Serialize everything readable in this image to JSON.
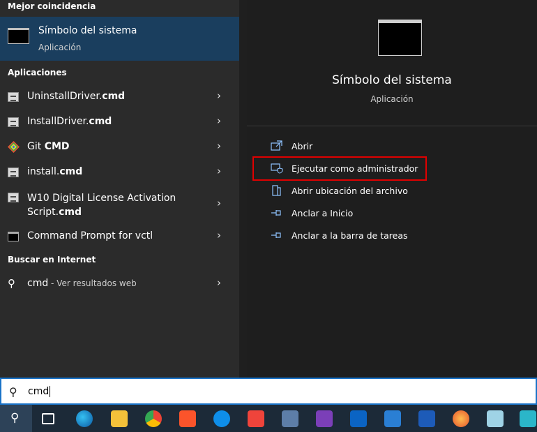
{
  "left": {
    "best_match_heading": "Mejor coincidencia",
    "best_match": {
      "title": "Símbolo del sistema",
      "subtitle": "Aplicación"
    },
    "apps_heading": "Aplicaciones",
    "apps": [
      {
        "name_prefix": "UninstallDriver.",
        "name_bold": "cmd",
        "name_line2": "",
        "icon": "script-file-icon"
      },
      {
        "name_prefix": "InstallDriver.",
        "name_bold": "cmd",
        "name_line2": "",
        "icon": "script-file-icon"
      },
      {
        "name_prefix": "Git ",
        "name_bold": "CMD",
        "name_line2": "",
        "icon": "git-icon"
      },
      {
        "name_prefix": "install.",
        "name_bold": "cmd",
        "name_line2": "",
        "icon": "script-file-icon"
      },
      {
        "name_prefix": "W10 Digital License Activation",
        "name_bold": "cmd",
        "name_line2": "Script.",
        "icon": "script-file-icon"
      },
      {
        "name_prefix": "Command Prompt for vctl",
        "name_bold": "",
        "name_line2": "",
        "icon": "command-prompt-icon"
      }
    ],
    "web_heading": "Buscar en Internet",
    "web": {
      "query": "cmd",
      "suffix": " - Ver resultados web"
    }
  },
  "preview": {
    "title": "Símbolo del sistema",
    "subtitle": "Aplicación",
    "actions": [
      {
        "label": "Abrir",
        "icon": "open-icon"
      },
      {
        "label": "Ejecutar como administrador",
        "icon": "shield-icon"
      },
      {
        "label": "Abrir ubicación del archivo",
        "icon": "file-location-icon"
      },
      {
        "label": "Anclar a Inicio",
        "icon": "pin-icon"
      },
      {
        "label": "Anclar a la barra de tareas",
        "icon": "pin-icon"
      }
    ]
  },
  "search": {
    "value": "cmd"
  },
  "taskbar": {
    "icons": [
      "search-icon",
      "task-view-icon",
      "edge-icon",
      "file-explorer-icon",
      "chrome-icon",
      "brave-icon",
      "teamviewer-icon",
      "anydesk-icon",
      "network-icon",
      "onenote-icon",
      "outlook-icon",
      "todo-icon",
      "word-icon",
      "firefox-icon",
      "notepad-icon",
      "vpn-icon"
    ]
  },
  "colors": {
    "accent": "#1a73c8",
    "selection": "#1a3e5e",
    "highlight_box": "#e00000"
  }
}
